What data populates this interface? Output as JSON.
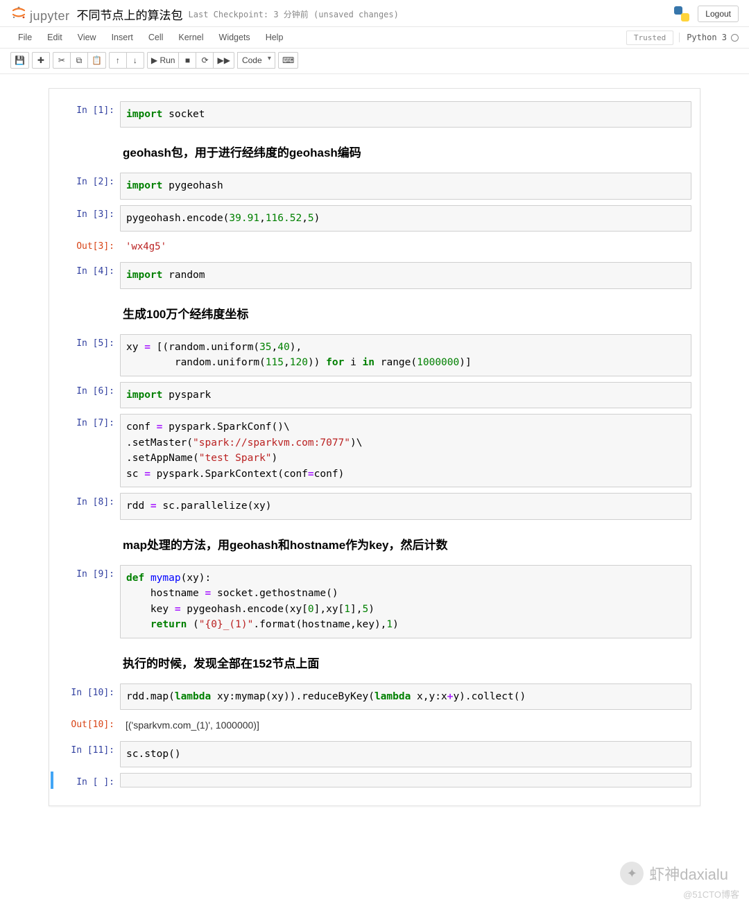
{
  "header": {
    "brand": "jupyter",
    "notebook_name": "不同节点上的算法包",
    "checkpoint": "Last Checkpoint: 3 分钟前  (unsaved changes)",
    "logout": "Logout"
  },
  "menubar": {
    "items": [
      "File",
      "Edit",
      "View",
      "Insert",
      "Cell",
      "Kernel",
      "Widgets",
      "Help"
    ],
    "trusted": "Trusted",
    "kernel": "Python 3"
  },
  "toolbar": {
    "save": "💾",
    "add": "✚",
    "cut": "✂",
    "copy": "⧉",
    "paste": "📋",
    "up": "↑",
    "down": "↓",
    "run_label": "▶ Run",
    "stop": "■",
    "restart": "⟳",
    "restart_run": "▶▶",
    "cell_type": "Code",
    "cmd": "⌨"
  },
  "cells": {
    "in1_prompt": "In [1]:",
    "in2_prompt": "In [2]:",
    "in3_prompt": "In [3]:",
    "out3_prompt": "Out[3]:",
    "in4_prompt": "In [4]:",
    "in5_prompt": "In [5]:",
    "in6_prompt": "In [6]:",
    "in7_prompt": "In [7]:",
    "in8_prompt": "In [8]:",
    "in9_prompt": "In [9]:",
    "in10_prompt": "In [10]:",
    "out10_prompt": "Out[10]:",
    "in11_prompt": "In [11]:",
    "in_empty_prompt": "In [ ]:",
    "md1": "geohash包，用于进行经纬度的geohash编码",
    "md2": "生成100万个经纬度坐标",
    "md3": "map处理的方法，用geohash和hostname作为key，然后计数",
    "md4": "执行的时候，发现全部在152节点上面",
    "out3": "'wx4g5'",
    "out10": "[('sparkvm.com_(1)', 1000000)]",
    "c1": {
      "kw": "import",
      "mod": "socket"
    },
    "c2": {
      "kw": "import",
      "mod": "pygeohash"
    },
    "c3": {
      "pre": "pygeohash.encode(",
      "a": "39.91",
      "b": "116.52",
      "c": "5",
      "post": ")"
    },
    "c4": {
      "kw": "import",
      "mod": "random"
    },
    "c5": {
      "l1_a": "xy ",
      "l1_eq": "=",
      "l1_b": " [(random.uniform(",
      "l1_n1": "35",
      "l1_n2": "40",
      "l1_c": "),",
      "l2_a": "        random.uniform(",
      "l2_n1": "115",
      "l2_n2": "120",
      "l2_b": ")) ",
      "l2_for": "for",
      "l2_c": " i ",
      "l2_in": "in",
      "l2_d": " range(",
      "l2_n3": "1000000",
      "l2_e": ")]"
    },
    "c6": {
      "kw": "import",
      "mod": "pyspark"
    },
    "c7": {
      "l1": "conf ",
      "eq": "=",
      "l1b": " pyspark.SparkConf()\\",
      "l2a": ".setMaster(",
      "l2s": "\"spark://sparkvm.com:7077\"",
      "l2b": ")\\",
      "l3a": ".setAppName(",
      "l3s": "\"test Spark\"",
      "l3b": ")",
      "l4a": "sc ",
      "l4eq": "=",
      "l4b": " pyspark.SparkContext(conf",
      "l4eq2": "=",
      "l4c": "conf)"
    },
    "c8": {
      "a": "rdd ",
      "eq": "=",
      "b": " sc.parallelize(xy)"
    },
    "c9": {
      "l1_def": "def",
      "l1_sp": " ",
      "l1_fn": "mymap",
      "l1_rest": "(xy):",
      "l2a": "    hostname ",
      "l2eq": "=",
      "l2b": " socket.gethostname()",
      "l3a": "    key ",
      "l3eq": "=",
      "l3b": " pygeohash.encode(xy[",
      "l3n0": "0",
      "l3c": "],xy[",
      "l3n1": "1",
      "l3d": "],",
      "l3n2": "5",
      "l3e": ")",
      "l4ret": "return",
      "l4sp": " ",
      "l4a": "(",
      "l4s": "\"{0}_(1)\"",
      "l4b": ".format(hostname,key),",
      "l4n": "1",
      "l4c": ")"
    },
    "c10": {
      "a": "rdd.map(",
      "lam": "lambda",
      "b": " xy:mymap(xy)).reduceByKey(",
      "lam2": "lambda",
      "c": " x,y:x",
      "plus": "+",
      "d": "y).collect()"
    },
    "c11": {
      "a": "sc.stop()"
    }
  },
  "watermark": {
    "text": "虾神daxialu",
    "sub": "@51CTO博客"
  }
}
